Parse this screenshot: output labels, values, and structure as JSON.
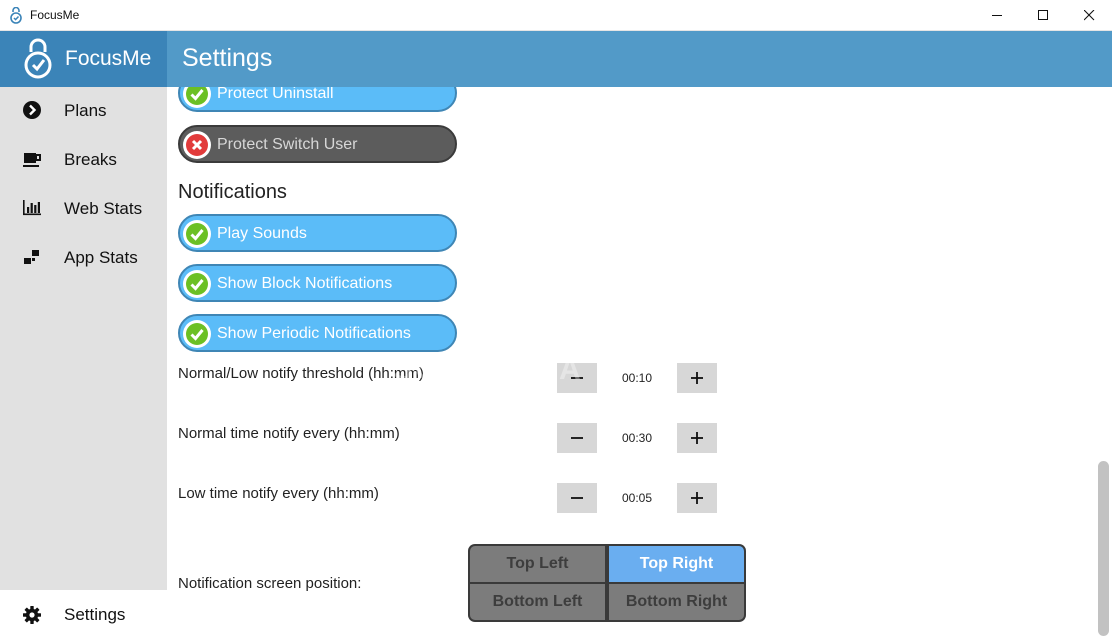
{
  "window": {
    "title": "FocusMe"
  },
  "brand": {
    "name": "FocusMe",
    "logo_icon": "stopwatch-lock-icon"
  },
  "header": {
    "page_title": "Settings",
    "colors": {
      "header": "#529ac8",
      "brand": "#3b84b8"
    }
  },
  "sidebar": {
    "items": [
      {
        "label": "Plans",
        "icon": "chevron-circle-right-icon"
      },
      {
        "label": "Breaks",
        "icon": "coffee-cup-icon"
      },
      {
        "label": "Web Stats",
        "icon": "bar-chart-icon"
      },
      {
        "label": "App Stats",
        "icon": "app-blocks-icon"
      }
    ],
    "settings": {
      "label": "Settings",
      "icon": "gear-icon",
      "active": true
    }
  },
  "protection": {
    "toggles": [
      {
        "label": "Protect Uninstall",
        "on": true
      },
      {
        "label": "Protect Switch User",
        "on": false
      }
    ]
  },
  "notifications": {
    "heading": "Notifications",
    "toggles": [
      {
        "label": "Play Sounds",
        "on": true
      },
      {
        "label": "Show Block Notifications",
        "on": true
      },
      {
        "label": "Show Periodic Notifications",
        "on": true
      }
    ],
    "steppers": [
      {
        "label": "Normal/Low notify threshold (hh:mm)",
        "value": "00:10"
      },
      {
        "label": "Normal time notify every (hh:mm)",
        "value": "00:30"
      },
      {
        "label": "Low time notify every (hh:mm)",
        "value": "00:05"
      }
    ],
    "position": {
      "label": "Notification screen position:",
      "options": [
        "Top Left",
        "Top Right",
        "Bottom Left",
        "Bottom Right"
      ],
      "selected": "Top Right"
    },
    "colors": {
      "toggle_on": "#5bbcf8",
      "toggle_off": "#5c5c5c",
      "check": "#6cc024",
      "cross": "#e23b3b",
      "selected_position": "#6aaef0"
    }
  },
  "watermark": "SOFTPEDIA"
}
